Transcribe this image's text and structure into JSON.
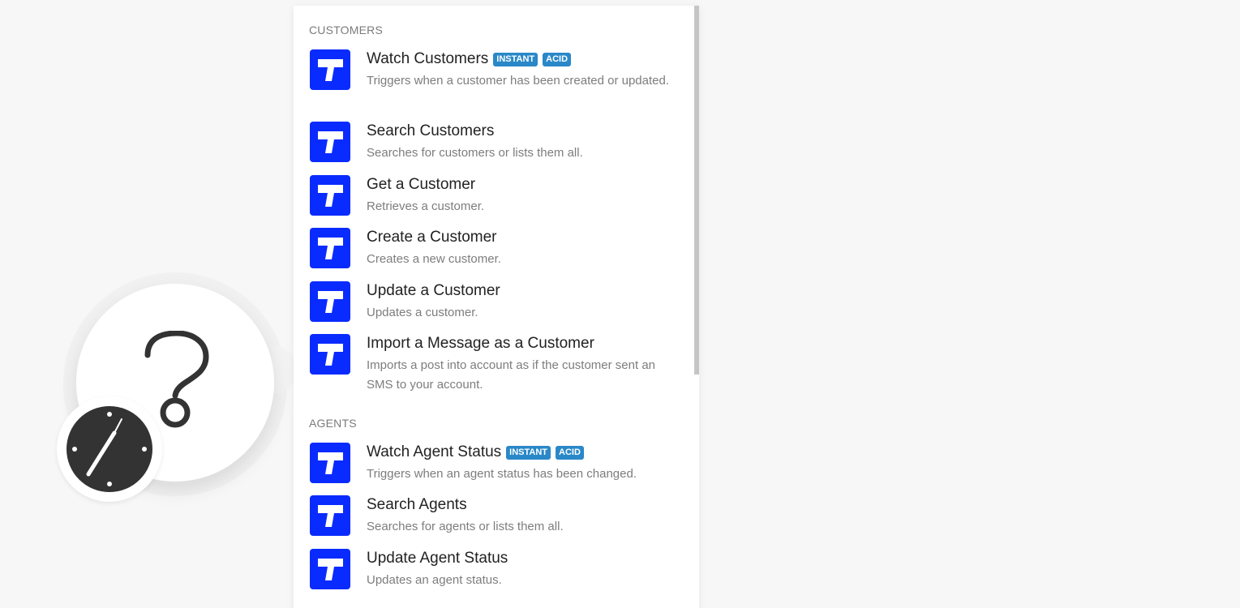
{
  "sections": [
    {
      "title": "CUSTOMERS",
      "items": [
        {
          "title": "Watch Customers",
          "badges": [
            "INSTANT",
            "ACID"
          ],
          "description": "Triggers when a customer has been created or updated."
        },
        {
          "title": "Search Customers",
          "description": "Searches for customers or lists them all."
        },
        {
          "title": "Get a Customer",
          "description": "Retrieves a customer."
        },
        {
          "title": "Create a Customer",
          "description": "Creates a new customer."
        },
        {
          "title": "Update a Customer",
          "description": "Updates a customer."
        },
        {
          "title": "Import a Message as a Customer",
          "description": "Imports a post into account as if the customer sent an SMS to your account."
        }
      ]
    },
    {
      "title": "AGENTS",
      "items": [
        {
          "title": "Watch Agent Status",
          "badges": [
            "INSTANT",
            "ACID"
          ],
          "description": "Triggers when an agent status has been changed."
        },
        {
          "title": "Search Agents",
          "description": "Searches for agents or lists them all."
        },
        {
          "title": "Update Agent Status",
          "description": "Updates an agent status."
        }
      ]
    }
  ],
  "colors": {
    "app_icon_bg": "#0a2bff",
    "badge_bg": "#2a88c8",
    "clock_bg": "#333333"
  },
  "icons": {
    "app": "app-t-logo-icon",
    "module": "question-mark-icon",
    "schedule": "clock-icon"
  }
}
